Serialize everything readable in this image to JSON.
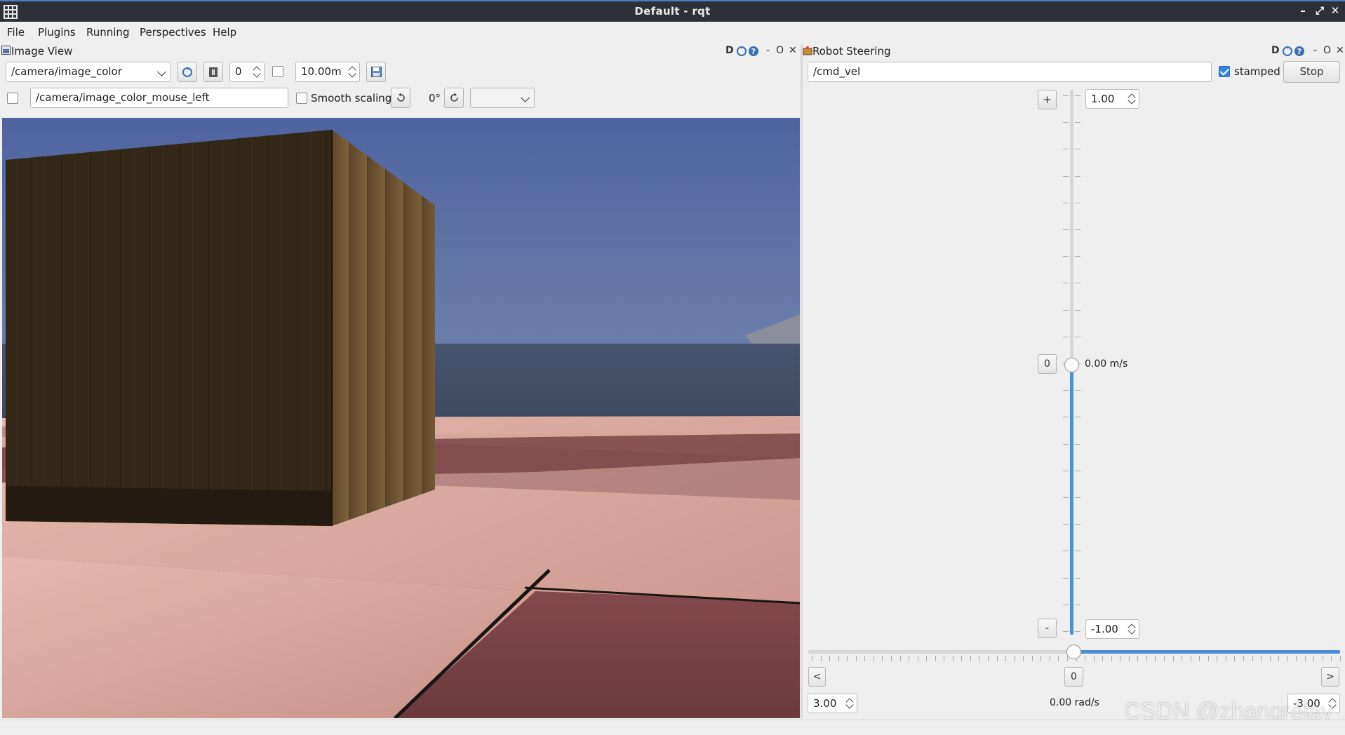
{
  "window": {
    "title": "Default - rqt"
  },
  "menu": [
    "File",
    "Plugins",
    "Running",
    "Perspectives",
    "Help"
  ],
  "image_view": {
    "title": "Image View",
    "topic": "/camera/image_color",
    "spin_value": "0",
    "range_value": "10.00m",
    "mouse_topic": "/camera/image_color_mouse_left",
    "smooth_scaling_label": "Smooth scaling",
    "rotation_label": "0°",
    "panel_controls": "D",
    "colors": {
      "sky": "#5a73a8",
      "crate_front": "#332818",
      "crate_side": "#6e5330",
      "floor_light": "#d9a89e",
      "floor_dark": "#7a4447"
    }
  },
  "robot_steering": {
    "title": "Robot Steering",
    "topic": "/cmd_vel",
    "stamped_label": "stamped",
    "stamped_checked": true,
    "stop_label": "Stop",
    "plus_label": "+",
    "minus_label": "-",
    "zero_label": "0",
    "max_linear": "1.00",
    "min_linear": "-1.00",
    "linear_value_text": "0.00 m/s",
    "left_label": "<",
    "right_label": ">",
    "hzero_label": "0",
    "max_angular": "3.00",
    "min_angular": "-3.00",
    "angular_value_text": "0.00 rad/s",
    "accent": "#4c8fd6"
  },
  "watermark": "CSDN @zhangrelay"
}
